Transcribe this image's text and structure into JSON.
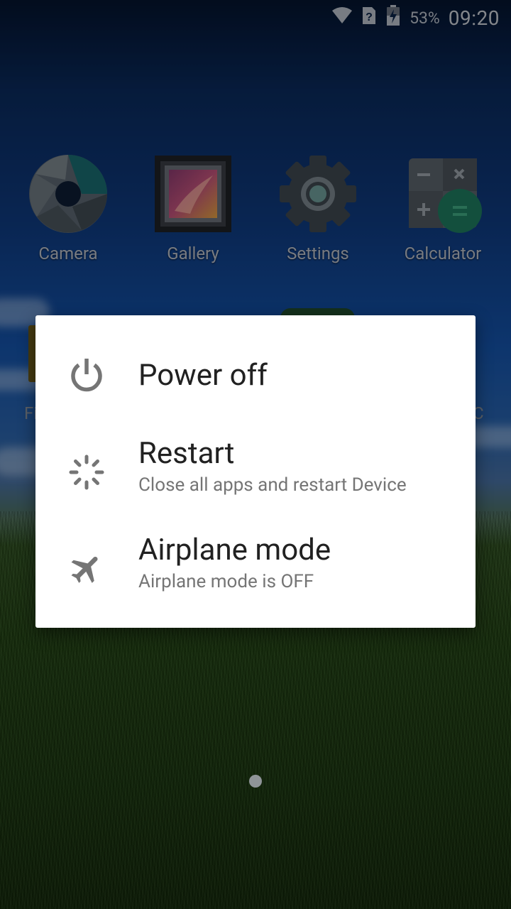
{
  "status_bar": {
    "battery_percent": "53%",
    "time": "09:20",
    "icons": [
      "wifi-icon",
      "no-sim-icon",
      "battery-charging-icon"
    ]
  },
  "apps_row1": [
    {
      "label": "Camera",
      "icon": "camera-icon"
    },
    {
      "label": "Gallery",
      "icon": "gallery-icon"
    },
    {
      "label": "Settings",
      "icon": "settings-icon"
    },
    {
      "label": "Calculator",
      "icon": "calculator-icon"
    }
  ],
  "apps_row2_partial": {
    "left_label_fragment": "Fi",
    "right_label_fragment": "C"
  },
  "power_menu": {
    "options": [
      {
        "title": "Power off",
        "subtitle": "",
        "icon": "power-icon"
      },
      {
        "title": "Restart",
        "subtitle": "Close all apps and restart Device",
        "icon": "restart-icon"
      },
      {
        "title": "Airplane mode",
        "subtitle": "Airplane mode is OFF",
        "icon": "airplane-icon"
      }
    ]
  },
  "colors": {
    "dialog_bg": "#ffffff",
    "title_text": "#212121",
    "subtitle_text": "#757575",
    "icon_gray": "#757575"
  }
}
